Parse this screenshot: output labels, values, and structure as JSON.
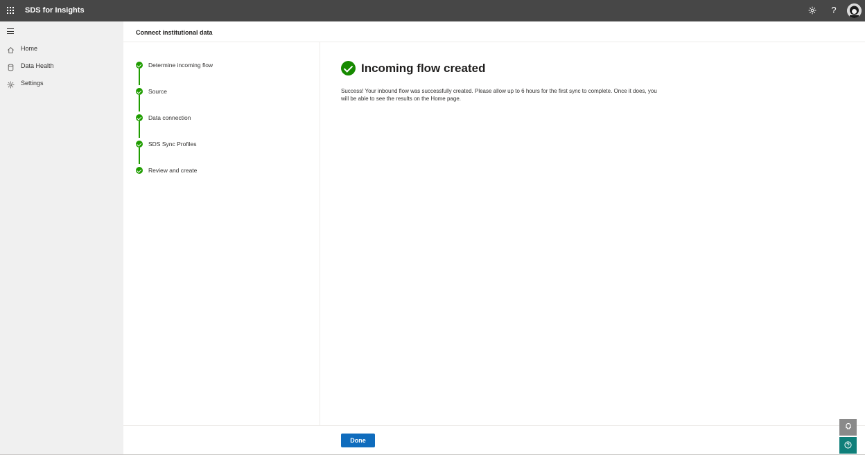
{
  "app": {
    "title": "SDS for Insights"
  },
  "topbar": {
    "icons": [
      "waffle-icon",
      "gear-icon",
      "help-icon",
      "avatar"
    ],
    "help_glyph": "?"
  },
  "nav": {
    "items": [
      {
        "label": "Home",
        "icon": "home-icon"
      },
      {
        "label": "Data Health",
        "icon": "database-icon"
      },
      {
        "label": "Settings",
        "icon": "gear-icon"
      }
    ]
  },
  "page": {
    "title": "Connect institutional data"
  },
  "steps": [
    {
      "label": "Determine incoming flow",
      "status": "complete"
    },
    {
      "label": "Source",
      "status": "complete"
    },
    {
      "label": "Data connection",
      "status": "complete"
    },
    {
      "label": "SDS Sync Profiles",
      "status": "complete"
    },
    {
      "label": "Review and create",
      "status": "complete"
    }
  ],
  "main": {
    "title": "Incoming flow created",
    "message": "Success! Your inbound flow was successfully created. Please allow up to 6 hours for the first sync to complete. Once it does, you will be able to see the results on the Home page."
  },
  "footer": {
    "done_label": "Done"
  },
  "colors": {
    "topbar": "#474747",
    "success": "#1f9d00",
    "primary": "#0f6cbd",
    "nav_bg": "#f0f0f0"
  }
}
